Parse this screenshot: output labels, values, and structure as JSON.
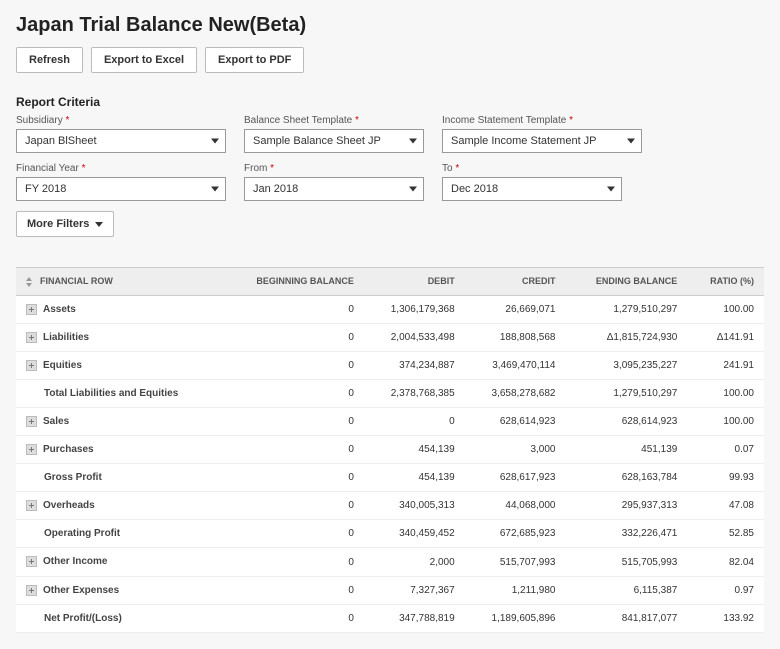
{
  "page_title": "Japan Trial Balance New(Beta)",
  "buttons": {
    "refresh": "Refresh",
    "excel": "Export to Excel",
    "pdf": "Export to PDF",
    "more_filters": "More Filters"
  },
  "criteria_title": "Report Criteria",
  "fields": {
    "subsidiary": {
      "label": "Subsidiary",
      "value": "Japan BlSheet"
    },
    "bs_template": {
      "label": "Balance Sheet Template",
      "value": "Sample Balance Sheet JP"
    },
    "is_template": {
      "label": "Income Statement Template",
      "value": "Sample Income Statement JP"
    },
    "fy": {
      "label": "Financial Year",
      "value": "FY 2018"
    },
    "from": {
      "label": "From",
      "value": "Jan 2018"
    },
    "to": {
      "label": "To",
      "value": "Dec 2018"
    }
  },
  "columns": {
    "row": "Financial Row",
    "bb": "Beginning Balance",
    "debit": "Debit",
    "credit": "Credit",
    "eb": "Ending Balance",
    "ratio": "Ratio (%)"
  },
  "rows": [
    {
      "exp": true,
      "indent": false,
      "label": "Assets",
      "bb": "0",
      "debit": "1,306,179,368",
      "credit": "26,669,071",
      "eb": "1,279,510,297",
      "ratio": "100.00"
    },
    {
      "exp": true,
      "indent": false,
      "label": "Liabilities",
      "bb": "0",
      "debit": "2,004,533,498",
      "credit": "188,808,568",
      "eb": "Δ1,815,724,930",
      "ratio": "Δ141.91"
    },
    {
      "exp": true,
      "indent": false,
      "label": "Equities",
      "bb": "0",
      "debit": "374,234,887",
      "credit": "3,469,470,114",
      "eb": "3,095,235,227",
      "ratio": "241.91"
    },
    {
      "exp": false,
      "indent": true,
      "label": "Total Liabilities and Equities",
      "bb": "0",
      "debit": "2,378,768,385",
      "credit": "3,658,278,682",
      "eb": "1,279,510,297",
      "ratio": "100.00"
    },
    {
      "exp": true,
      "indent": false,
      "label": "Sales",
      "bb": "0",
      "debit": "0",
      "credit": "628,614,923",
      "eb": "628,614,923",
      "ratio": "100.00"
    },
    {
      "exp": true,
      "indent": false,
      "label": "Purchases",
      "bb": "0",
      "debit": "454,139",
      "credit": "3,000",
      "eb": "451,139",
      "ratio": "0.07"
    },
    {
      "exp": false,
      "indent": true,
      "label": "Gross Profit",
      "bb": "0",
      "debit": "454,139",
      "credit": "628,617,923",
      "eb": "628,163,784",
      "ratio": "99.93"
    },
    {
      "exp": true,
      "indent": false,
      "label": "Overheads",
      "bb": "0",
      "debit": "340,005,313",
      "credit": "44,068,000",
      "eb": "295,937,313",
      "ratio": "47.08"
    },
    {
      "exp": false,
      "indent": true,
      "label": "Operating Profit",
      "bb": "0",
      "debit": "340,459,452",
      "credit": "672,685,923",
      "eb": "332,226,471",
      "ratio": "52.85"
    },
    {
      "exp": true,
      "indent": false,
      "label": "Other Income",
      "bb": "0",
      "debit": "2,000",
      "credit": "515,707,993",
      "eb": "515,705,993",
      "ratio": "82.04"
    },
    {
      "exp": true,
      "indent": false,
      "label": "Other Expenses",
      "bb": "0",
      "debit": "7,327,367",
      "credit": "1,211,980",
      "eb": "6,115,387",
      "ratio": "0.97"
    },
    {
      "exp": false,
      "indent": true,
      "label": "Net Profit/(Loss)",
      "bb": "0",
      "debit": "347,788,819",
      "credit": "1,189,605,896",
      "eb": "841,817,077",
      "ratio": "133.92"
    }
  ]
}
